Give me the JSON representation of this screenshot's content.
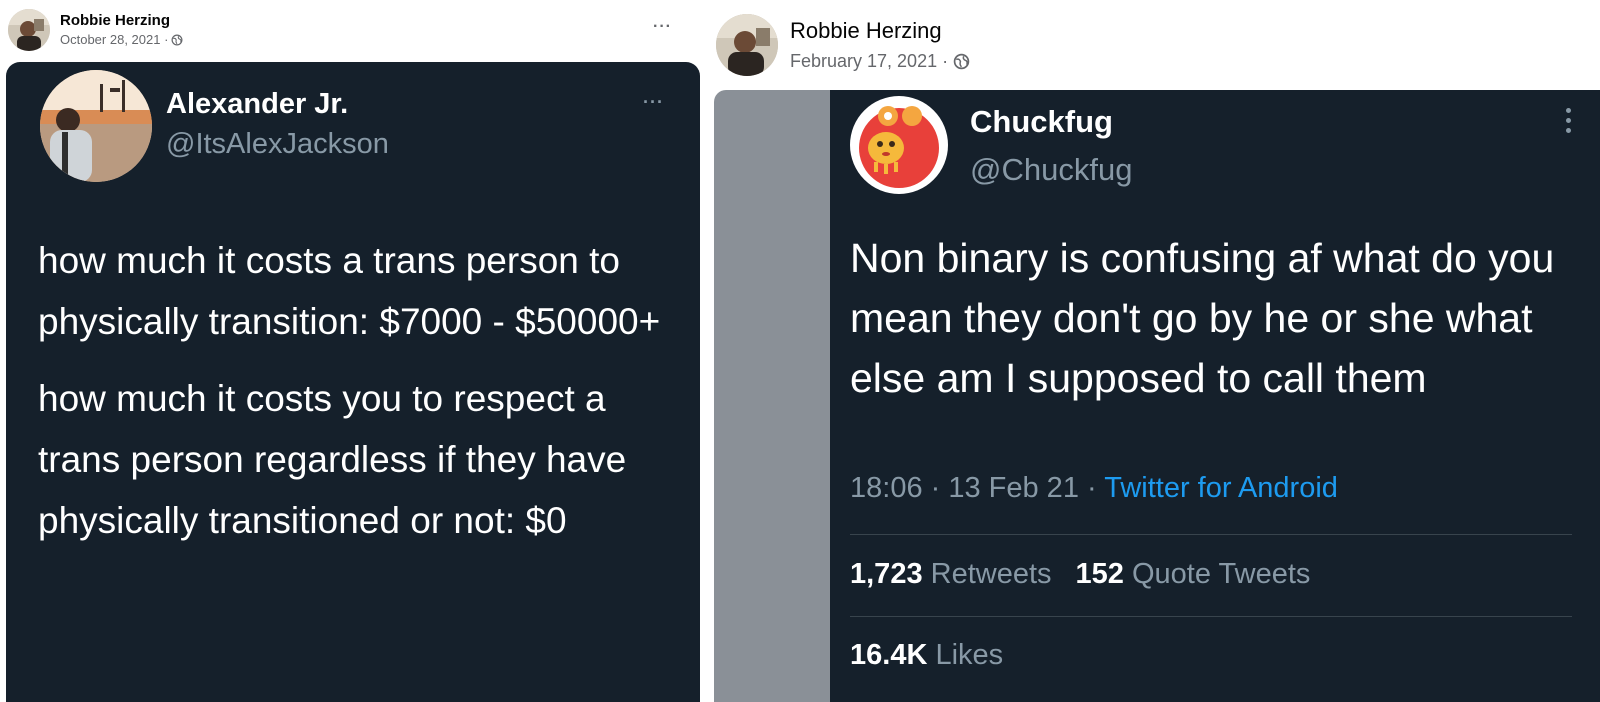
{
  "left_post": {
    "author": "Robbie Herzing",
    "date": "October 28, 2021 ·",
    "more": "···",
    "tweet": {
      "name": "Alexander Jr.",
      "handle": "@ItsAlexJackson",
      "more": "···",
      "paragraphs": [
        "how much it costs a trans person to physically transition: $7000 - $50000+",
        "how much it costs you to respect a trans person regardless if they have physically transitioned or not: $0"
      ]
    }
  },
  "right_post": {
    "author": "Robbie Herzing",
    "date": "February 17, 2021 ·",
    "tweet": {
      "name": "Chuckfug",
      "handle": "@Chuckfug",
      "text": "Non binary is confusing af what do you mean they don't go by he or she what else am I supposed to call them",
      "time": "18:06 · 13 Feb 21 · ",
      "client": "Twitter for Android",
      "retweets_count": "1,723",
      "retweets_label": "Retweets",
      "quotes_count": "152",
      "quotes_label": "Quote Tweets",
      "likes_count": "16.4K",
      "likes_label": "Likes"
    }
  },
  "icons": {
    "globe": "globe-icon",
    "more": "more-horizontal-icon",
    "more_vertical": "more-vertical-icon"
  },
  "colors": {
    "tweet_bg": "#15202b",
    "twitter_blue": "#1d9bf0",
    "muted": "#8899a6"
  }
}
